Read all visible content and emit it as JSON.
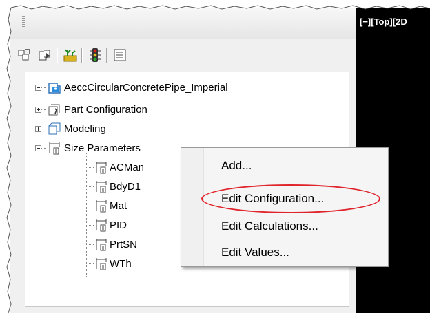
{
  "viewport": {
    "label": "[−][Top][2D"
  },
  "toolbar": {
    "icons": [
      "part-builder-icon",
      "browse-icon",
      "plant-icon",
      "traffic-light-icon",
      "list-icon"
    ]
  },
  "tree": {
    "root": {
      "label": "AeccCircularConcretePipe_Imperial",
      "icon": "part-root-icon"
    },
    "children": [
      {
        "label": "Part Configuration",
        "icon": "part-config-icon",
        "expanded": false
      },
      {
        "label": "Modeling",
        "icon": "modeling-icon",
        "expanded": false
      },
      {
        "label": "Size Parameters",
        "icon": "size-param-icon",
        "expanded": true
      }
    ],
    "size_params": [
      "ACMan",
      "BdyD1",
      "Mat",
      "PID",
      "PrtSN",
      "WTh"
    ]
  },
  "context_menu": {
    "items": [
      "Add...",
      "Edit Configuration...",
      "Edit Calculations...",
      "Edit Values..."
    ],
    "highlighted": "Edit Configuration...",
    "highlight_color": "#e0242c"
  },
  "colors": {
    "viewport_bg": "#000000",
    "panel_bg": "#f0f0f0",
    "menu_bg": "#f5f5f5"
  }
}
